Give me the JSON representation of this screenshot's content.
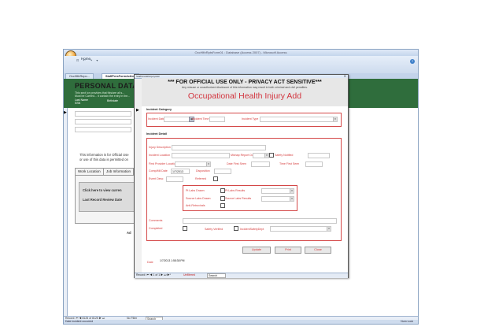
{
  "app": {
    "title": "OccHlthRptsForm01 : Database (Access 2007) - Microsoft Access",
    "ribbon_tab": "Home",
    "quick_access": "⊡ ↶ ↷ ▾",
    "help_label": "?"
  },
  "doc_tabs": [
    "OccHlthRepo...",
    "StaffPersFormAction"
  ],
  "background_form": {
    "header_title": "PERSONAL DATA SH",
    "header_subtitle_1": "This sect ion provides that this/are all s...",
    "header_subtitle_2": "Must be  Carried... It contain the entry in the...",
    "last_name_label": "Last Name",
    "last_name_sub": "SSN",
    "birthdate_label": "Birthdate",
    "notice_1": "This information is for Official Use",
    "notice_2": "or use of this data is permitted on",
    "tabs": [
      "Work Location",
      "Job Information"
    ],
    "panel_line_1": "Click here to view curren",
    "panel_line_2": "Last Record Review Date",
    "add_label": "Ad",
    "nav_record": "Record: ⏮ ◀ 8125 of 8125 ▶ ⏭",
    "nav_filter": "No Filter",
    "nav_search": "Search"
  },
  "status_bar": {
    "left": "Date incident occurred",
    "right": "Num Lock"
  },
  "popup": {
    "title": "StaffOccHlthInjuryAdd",
    "close_glyph": "✕",
    "warning": "*** FOR OFFICIAL USE ONLY - PRIVACY ACT SENSITIVE***",
    "warning_sub": "Any misuse or unauthorized disclosure of this information may result in both criminal and civil penalties.",
    "form_title": "Occupational Health Injury Add",
    "incident_category": {
      "section": "Incident Category",
      "incident_date_label": "Incident Date",
      "incident_time_label": "Incident Time",
      "incident_type_label": "Incident Type"
    },
    "incident_detail": {
      "section": "Incident Detail",
      "injury_description": "Injury Description",
      "incident_location": "Incident Location",
      "mishap_report_done": "Mishap Report Done",
      "safety_notified": "Safety Notified",
      "first_provider_location": "First Provider Location",
      "date_first_seen": "Date First Seen",
      "time_first_seen": "Time First Seen",
      "comp_mil_date": "Comp/Mil Date",
      "comp_mil_date_value": "1/7/2013",
      "disposition": "Disposition",
      "event_desc": "Event Desc",
      "referred": "Referred",
      "pt_labs_drawn": "Pt Labs Drawn",
      "pt_labs_results": "Pt Labs Results",
      "source_labs_drawn": "Source Labs Drawn",
      "source_labs_results": "Source Labs Results",
      "anti_retrovirals": "Anti-Retrovirals",
      "comments": "Comments",
      "completed": "Completed",
      "safety_verified": "Safety Verified",
      "incident_safety_dept": "IncidentSafetyDept"
    },
    "buttons": {
      "update": "Update",
      "print": "Print",
      "close": "Close"
    },
    "date_label": "Date",
    "date_value": "1/7/2013 1:58:38 PM",
    "nav": {
      "record": "Record: ⏮ ◀ 1 of 1 ▶ ⏭ ▶*",
      "filter": "Unfiltered",
      "search": "Search"
    }
  },
  "colors": {
    "header_green": "#2f6d3c",
    "label_red": "#d53a3a",
    "title_red": "#d2343e"
  }
}
